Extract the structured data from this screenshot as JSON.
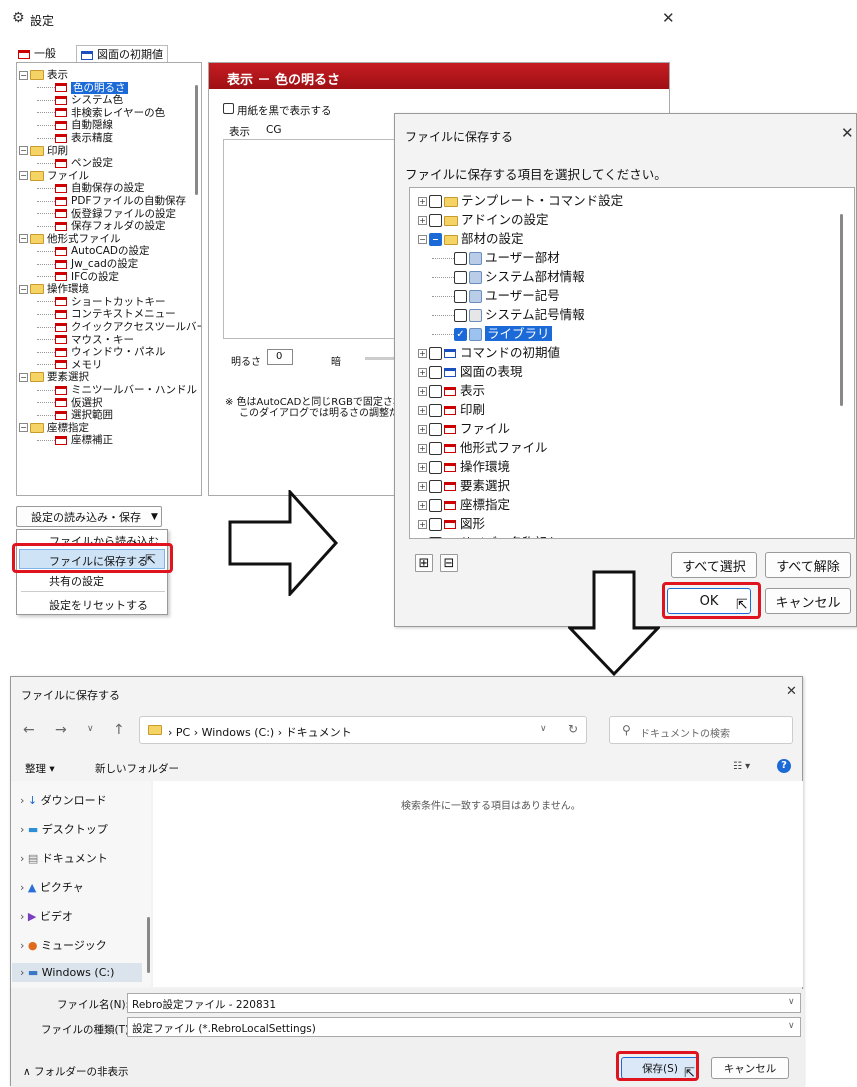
{
  "settings": {
    "title": "設定",
    "tabs": [
      "一般",
      "図面の初期値"
    ],
    "tree": [
      {
        "label": "表示",
        "level": 0,
        "folder": true
      },
      {
        "label": "色の明るさ",
        "level": 1,
        "selected": true
      },
      {
        "label": "システム色",
        "level": 1
      },
      {
        "label": "非検索レイヤーの色",
        "level": 1
      },
      {
        "label": "自動隠線",
        "level": 1
      },
      {
        "label": "表示精度",
        "level": 1
      },
      {
        "label": "印刷",
        "level": 0,
        "folder": true
      },
      {
        "label": "ペン設定",
        "level": 1
      },
      {
        "label": "ファイル",
        "level": 0,
        "folder": true
      },
      {
        "label": "自動保存の設定",
        "level": 1
      },
      {
        "label": "PDFファイルの自動保存",
        "level": 1
      },
      {
        "label": "仮登録ファイルの設定",
        "level": 1
      },
      {
        "label": "保存フォルダの設定",
        "level": 1
      },
      {
        "label": "他形式ファイル",
        "level": 0,
        "folder": true
      },
      {
        "label": "AutoCADの設定",
        "level": 1
      },
      {
        "label": "Jw_cadの設定",
        "level": 1
      },
      {
        "label": "IFCの設定",
        "level": 1
      },
      {
        "label": "操作環境",
        "level": 0,
        "folder": true
      },
      {
        "label": "ショートカットキー",
        "level": 1
      },
      {
        "label": "コンテキストメニュー",
        "level": 1
      },
      {
        "label": "クイックアクセスツールバー",
        "level": 1
      },
      {
        "label": "マウス・キー",
        "level": 1
      },
      {
        "label": "ウィンドウ・パネル",
        "level": 1
      },
      {
        "label": "メモリ",
        "level": 1
      },
      {
        "label": "要素選択",
        "level": 0,
        "folder": true
      },
      {
        "label": "ミニツールバー・ハンドル",
        "level": 1
      },
      {
        "label": "仮選択",
        "level": 1
      },
      {
        "label": "選択範囲",
        "level": 1
      },
      {
        "label": "座標指定",
        "level": 0,
        "folder": true
      },
      {
        "label": "座標補正",
        "level": 1
      }
    ],
    "panel_header": "表示 － 色の明るさ",
    "black_paper_label": "用紙を黒で表示する",
    "inner_tabs": [
      "表示",
      "CG"
    ],
    "brightness_label": "明るさ",
    "brightness_value": "0",
    "dark_label": "暗",
    "note_line1": "※ 色はAutoCADと同じRGBで固定され",
    "note_line2": "このダイアログでは明るさの調整だけ",
    "dropdown_button": "設定の読み込み・保存",
    "menu": [
      "ファイルから読み込む",
      "ファイルに保存する",
      "共有の設定",
      "設定をリセットする"
    ]
  },
  "save_items_dialog": {
    "title": "ファイルに保存する",
    "instruction": "ファイルに保存する項目を選択してください。",
    "tree": [
      {
        "label": "テンプレート・コマンド設定",
        "level": 0,
        "icon": "folder"
      },
      {
        "label": "アドインの設定",
        "level": 0,
        "icon": "folder"
      },
      {
        "label": "部材の設定",
        "level": 0,
        "icon": "folder",
        "state": "partial"
      },
      {
        "label": "ユーザー部材",
        "level": 1,
        "icon": "user-part-icon"
      },
      {
        "label": "システム部材情報",
        "level": 1,
        "icon": "system-part-icon"
      },
      {
        "label": "ユーザー記号",
        "level": 1,
        "icon": "user-symbol-icon"
      },
      {
        "label": "システム記号情報",
        "level": 1,
        "icon": "system-symbol-icon"
      },
      {
        "label": "ライブラリ",
        "level": 1,
        "icon": "library-icon",
        "state": "checked"
      },
      {
        "label": "コマンドの初期値",
        "level": 0,
        "icon": "blue"
      },
      {
        "label": "図面の表現",
        "level": 0,
        "icon": "blue"
      },
      {
        "label": "表示",
        "level": 0,
        "icon": "red"
      },
      {
        "label": "印刷",
        "level": 0,
        "icon": "red"
      },
      {
        "label": "ファイル",
        "level": 0,
        "icon": "red"
      },
      {
        "label": "他形式ファイル",
        "level": 0,
        "icon": "red"
      },
      {
        "label": "操作環境",
        "level": 0,
        "icon": "red"
      },
      {
        "label": "要素選択",
        "level": 0,
        "icon": "red"
      },
      {
        "label": "座標指定",
        "level": 0,
        "icon": "red"
      },
      {
        "label": "図形",
        "level": 0,
        "icon": "red"
      },
      {
        "label": "サイズ・名称記入",
        "level": 0,
        "icon": "red"
      }
    ],
    "expand_all": "⊞",
    "collapse_all": "⊟",
    "select_all": "すべて選択",
    "deselect_all": "すべて解除",
    "ok": "OK",
    "cancel": "キャンセル"
  },
  "file_dialog": {
    "title": "ファイルに保存する",
    "breadcrumb": [
      "PC",
      "Windows (C:)",
      "ドキュメント"
    ],
    "search_placeholder": "ドキュメントの検索",
    "organize": "整理 ▾",
    "new_folder": "新しいフォルダー",
    "nav": [
      "ダウンロード",
      "デスクトップ",
      "ドキュメント",
      "ピクチャ",
      "ビデオ",
      "ミュージック",
      "Windows (C:)"
    ],
    "empty_message": "検索条件に一致する項目はありません。",
    "filename_label": "ファイル名(N):",
    "filename_value": "Rebro設定ファイル - 220831",
    "filetype_label": "ファイルの種類(T):",
    "filetype_value": "設定ファイル (*.RebroLocalSettings)",
    "hide_folders": "フォルダーの非表示",
    "save": "保存(S)",
    "cancel": "キャンセル"
  },
  "colors": {
    "accent_red": "#e0141e",
    "header_red": "#b3131a",
    "select_blue": "#1b6ad8"
  }
}
